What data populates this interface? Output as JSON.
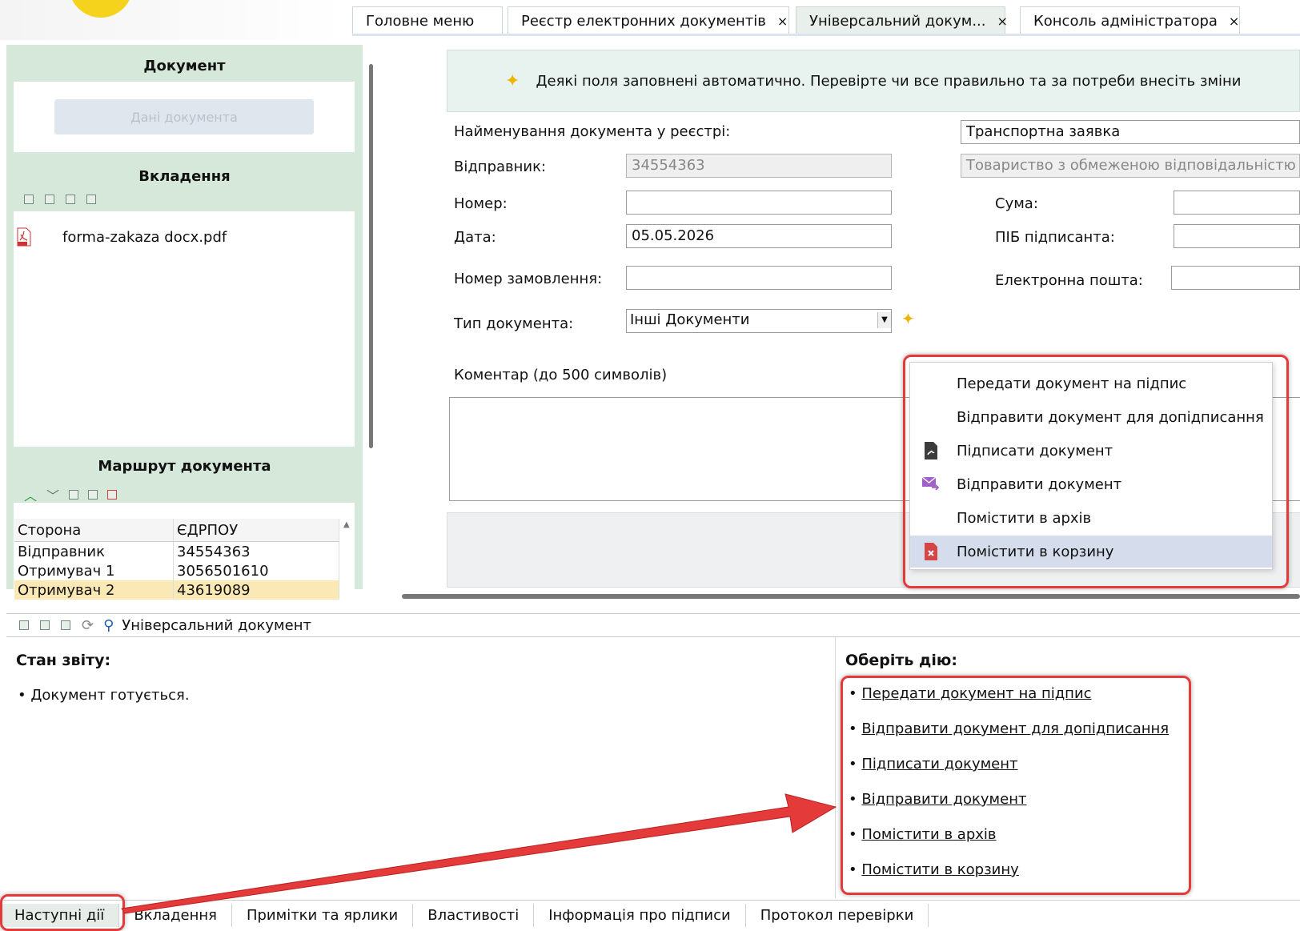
{
  "tabs": [
    {
      "label": "Головне меню",
      "closable": false
    },
    {
      "label": "Реєстр електронних документів",
      "closable": true
    },
    {
      "label": "Універсальний докум...",
      "closable": true,
      "active": true
    },
    {
      "label": "Консоль адміністратора",
      "closable": true
    }
  ],
  "tab_close_glyph": "×",
  "left": {
    "document_title": "Документ",
    "document_data_button": "Дані документа",
    "attachments_title": "Вкладення",
    "attachment_file": "forma-zakaza docx.pdf",
    "route_title": "Маршрут документа",
    "route_columns": [
      "Сторона",
      "ЄДРПОУ"
    ],
    "route_rows": [
      {
        "side": "Відправник",
        "code": "34554363"
      },
      {
        "side": "Отримувач 1",
        "code": "3056501610"
      },
      {
        "side": "Отримувач 2",
        "code": "43619089"
      }
    ]
  },
  "banner": {
    "text": "Деякі поля заповнені автоматично. Перевірте чи все правильно та за потреби внесіть зміни"
  },
  "form": {
    "name_label": "Найменування документа у реєстрі:",
    "name_value": "Транспортна заявка",
    "sender_label": "Відправник:",
    "sender_code": "34554363",
    "sender_name": "Товариство з обмеженою відповідальністю \"Ц",
    "number_label": "Номер:",
    "number_value": "",
    "sum_label": "Сума:",
    "date_label": "Дата:",
    "date_value": "05.05.2026",
    "signer_label": "ПІБ підписанта:",
    "order_label": "Номер замовлення:",
    "email_label": "Електронна пошта:",
    "type_label": "Тип документа:",
    "type_value": "Інші Документи",
    "comment_label": "Коментар (до 500 символів)"
  },
  "context_menu": [
    {
      "label": "Передати документ на підпис",
      "icon": ""
    },
    {
      "label": "Відправити документ для допідписання",
      "icon": ""
    },
    {
      "label": "Підписати документ",
      "icon": "sign-icon"
    },
    {
      "label": "Відправити документ",
      "icon": "send-mail-icon"
    },
    {
      "label": "Помістити в архів",
      "icon": ""
    },
    {
      "label": "Помістити в корзину",
      "icon": "trash-doc-icon",
      "highlighted": true
    }
  ],
  "bottom": {
    "toolbar_title": "Універсальний документ",
    "status_heading": "Стан звіту:",
    "status_item": "Документ готується.",
    "actions_heading": "Оберіть дію:",
    "actions": [
      "Передати документ на підпис",
      "Відправити документ для допідписання",
      "Підписати документ",
      "Відправити документ",
      "Помістити в архів",
      "Помістити в корзину"
    ],
    "tabs": [
      "Наступні дії",
      "Вкладення",
      "Примітки та ярлики",
      "Властивості",
      "Інформація про підписи",
      "Протокол перевірки"
    ]
  },
  "colors": {
    "highlight_red": "#e53a3a",
    "panel_green": "#d6e8da",
    "selected_row": "#fbe9b5",
    "menu_highlight": "#d5dcec"
  }
}
